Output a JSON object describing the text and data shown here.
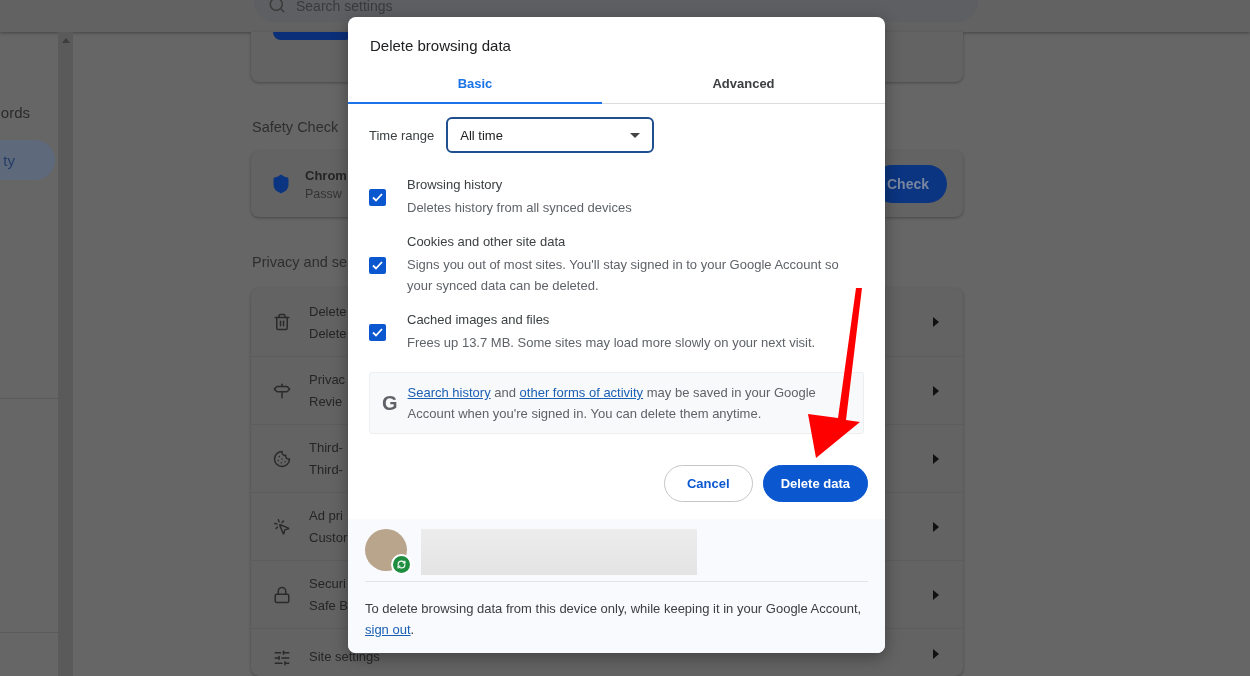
{
  "page": {
    "search": {
      "placeholder": "Search settings"
    },
    "sidebar": {
      "items": [
        {
          "label": "ords",
          "selected": false
        },
        {
          "label": "ty",
          "selected": true
        }
      ]
    },
    "safety_check": {
      "heading": "Safety Check",
      "title": "Chrom",
      "subtitle": "Passw",
      "button": "Check"
    },
    "privacy": {
      "heading": "Privacy and se",
      "rows": [
        {
          "kind": "trash",
          "title": "Delete",
          "subtitle": "Delete"
        },
        {
          "kind": "signpost",
          "title": "Privac",
          "subtitle": "Revie"
        },
        {
          "kind": "cookie",
          "title": "Third-",
          "subtitle": "Third-"
        },
        {
          "kind": "target",
          "title": "Ad pri",
          "subtitle": "Custor"
        },
        {
          "kind": "lock",
          "title": "Securi",
          "subtitle": "Safe B"
        },
        {
          "kind": "sliders",
          "title": "Site settings"
        }
      ]
    }
  },
  "dialog": {
    "title": "Delete browsing data",
    "tabs": [
      {
        "label": "Basic",
        "selected": true
      },
      {
        "label": "Advanced",
        "selected": false
      }
    ],
    "time_range": {
      "label": "Time range",
      "value": "All time"
    },
    "options": [
      {
        "title": "Browsing history",
        "description": "Deletes history from all synced devices",
        "checked": true
      },
      {
        "title": "Cookies and other site data",
        "description": "Signs you out of most sites. You'll stay signed in to your Google Account so your synced data can be deleted.",
        "checked": true
      },
      {
        "title": "Cached images and files",
        "description": "Frees up 13.7 MB. Some sites may load more slowly on your next visit.",
        "checked": true
      }
    ],
    "info": {
      "logo": "G",
      "parts": [
        {
          "kind": "link",
          "text": "Search history"
        },
        {
          "kind": "text",
          "text": " and "
        },
        {
          "kind": "link",
          "text": "other forms of activity"
        },
        {
          "kind": "text",
          "text": " may be saved in your Google Account when you're signed in. You can delete them anytime."
        }
      ]
    },
    "buttons": [
      {
        "label": "Cancel",
        "kind": "secondary"
      },
      {
        "label": "Delete data",
        "kind": "primary"
      }
    ],
    "footer": {
      "parts": [
        {
          "kind": "text",
          "text": "To delete browsing data from this device only, while keeping it in your Google Account, "
        },
        {
          "kind": "link",
          "text": "sign out"
        },
        {
          "kind": "text",
          "text": "."
        }
      ]
    }
  }
}
